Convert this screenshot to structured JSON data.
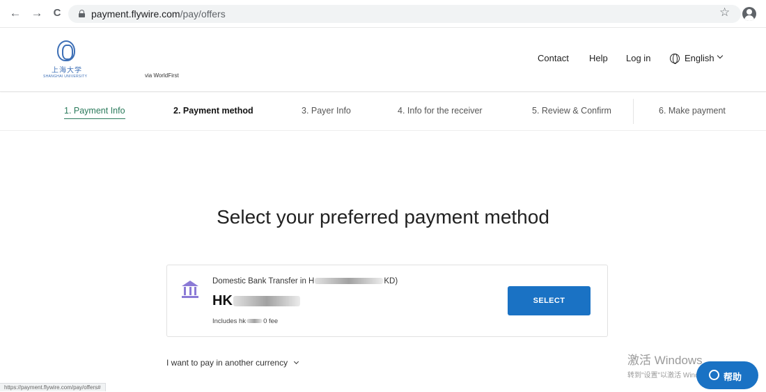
{
  "browser": {
    "url_host": "payment.flywire.com",
    "url_path": "/pay/offers",
    "back_glyph": "←",
    "forward_glyph": "→",
    "reload_glyph": "C",
    "star_glyph": "☆",
    "icons": [
      "back-arrow-icon",
      "forward-arrow-icon",
      "reload-icon",
      "lock-icon",
      "star-icon",
      "profile-icon"
    ]
  },
  "header": {
    "logo_cn": "上海大学",
    "logo_en": "SHANGHAI UNIVERSITY",
    "via": "via WorldFirst",
    "links": {
      "contact": "Contact",
      "help": "Help",
      "login": "Log in"
    },
    "language": "English"
  },
  "steps": [
    {
      "label": "1. Payment Info",
      "state": "done"
    },
    {
      "label": "2. Payment method",
      "state": "current"
    },
    {
      "label": "3. Payer Info",
      "state": "upcoming"
    },
    {
      "label": "4. Info for the receiver",
      "state": "upcoming"
    },
    {
      "label": "5. Review & Confirm",
      "state": "upcoming"
    },
    {
      "label": "6. Make payment",
      "state": "upcoming"
    }
  ],
  "main": {
    "title": "Select your preferred payment method",
    "offer": {
      "method_prefix": "Domestic Bank Transfer in H",
      "method_suffix": "KD)",
      "amount_prefix": "HK",
      "fee_prefix": "Includes hk",
      "fee_suffix": "0 fee",
      "button": "SELECT"
    },
    "other_currency": "I want to pay in another currency"
  },
  "overlays": {
    "watermark_title": "激活 Windows",
    "watermark_sub": "转到\"设置\"以激活 Windows。",
    "help_button": "帮助",
    "status_url": "https://payment.flywire.com/pay/offers#"
  },
  "colors": {
    "accent": "#1a72c4",
    "step_done": "#2a7a5b",
    "bank_icon": "#8b7ad6"
  }
}
